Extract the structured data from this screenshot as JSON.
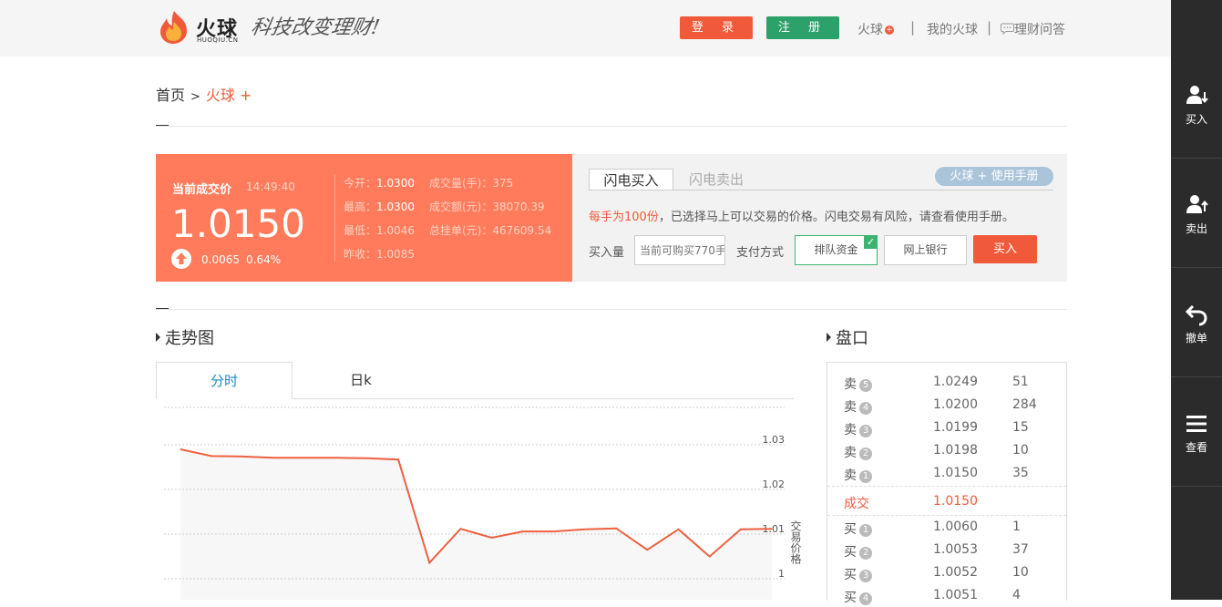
{
  "header": {
    "logo_text": "火球",
    "logo_sub": "HUOQIU.CN",
    "slogan": "科技改变理财!",
    "login_label": "登 录",
    "register_label": "注 册",
    "nav": [
      {
        "label": "火球"
      },
      {
        "label": "我的火球"
      },
      {
        "label": "理财问答"
      }
    ],
    "separator": "|"
  },
  "breadcrumb": {
    "home": "首页",
    "separator": ">",
    "current": "火球 +"
  },
  "price_panel": {
    "label": "当前成交价",
    "time": "14:49:40",
    "price": "1.0150",
    "change": "0.0065",
    "change_pct": "0.64%",
    "stats": {
      "open_label": "今开：",
      "open": "1.0300",
      "high_label": "最高：",
      "high": "1.0300",
      "low_label": "最低：",
      "low": "1.0046",
      "prev_close_label": "昨收：",
      "prev_close": "1.0085",
      "volume_label": "成交量(手)：",
      "volume": "375",
      "amount_label": "成交额(元)：",
      "amount": "38070.39",
      "total_orders_label": "总挂单(元)：",
      "total_orders": "467609.54"
    }
  },
  "trade_panel": {
    "tab_buy": "闪电买入",
    "tab_sell": "闪电卖出",
    "manual_label": "火球 + 使用手册",
    "desc_highlight": "每手为100份",
    "desc_rest": "，已选择马上可以交易的价格。闪电交易有风险，请查看使用手册。",
    "qty_label": "买入量",
    "qty_placeholder": "当前可购买770手",
    "pay_label": "支付方式",
    "pay_queue": "排队资金",
    "pay_bank": "网上银行",
    "buy_label": "买入",
    "accent_color": "#f05a3b",
    "selected_color": "#3cb371"
  },
  "trend": {
    "title": "走势图",
    "tab_intraday": "分时",
    "tab_daily": "日k"
  },
  "chart_data": {
    "type": "line",
    "y_ticks": [
      "1.03",
      "1.02",
      "1.01",
      "1"
    ],
    "ylabel": "交易价格",
    "grid": true,
    "series": [
      {
        "values": [
          1.03,
          1.0285,
          1.0284,
          1.0281,
          1.0281,
          1.0281,
          1.028,
          1.0277,
          1.0046,
          1.0122,
          1.0102,
          1.0116,
          1.0116,
          1.0121,
          1.0123,
          1.0075,
          1.0121,
          1.006,
          1.0121,
          1.0122
        ]
      }
    ],
    "line_color": "#ee6040"
  },
  "order_book": {
    "title": "盘口",
    "sell": [
      {
        "side": "卖",
        "level": "5",
        "price": "1.0249",
        "vol": "51"
      },
      {
        "side": "卖",
        "level": "4",
        "price": "1.0200",
        "vol": "284"
      },
      {
        "side": "卖",
        "level": "3",
        "price": "1.0199",
        "vol": "15"
      },
      {
        "side": "卖",
        "level": "2",
        "price": "1.0198",
        "vol": "10"
      },
      {
        "side": "卖",
        "level": "1",
        "price": "1.0150",
        "vol": "35"
      }
    ],
    "trade_label": "成交",
    "trade_price": "1.0150",
    "buy": [
      {
        "side": "买",
        "level": "1",
        "price": "1.0060",
        "vol": "1"
      },
      {
        "side": "买",
        "level": "2",
        "price": "1.0053",
        "vol": "37"
      },
      {
        "side": "买",
        "level": "3",
        "price": "1.0052",
        "vol": "10"
      },
      {
        "side": "买",
        "level": "4",
        "price": "1.0051",
        "vol": "4"
      }
    ]
  },
  "sidebar": {
    "items": [
      {
        "label": "买入",
        "icon": "user-buy-icon"
      },
      {
        "label": "卖出",
        "icon": "user-sell-icon"
      },
      {
        "label": "撤单",
        "icon": "undo-icon"
      },
      {
        "label": "查看",
        "icon": "menu-icon"
      }
    ]
  }
}
